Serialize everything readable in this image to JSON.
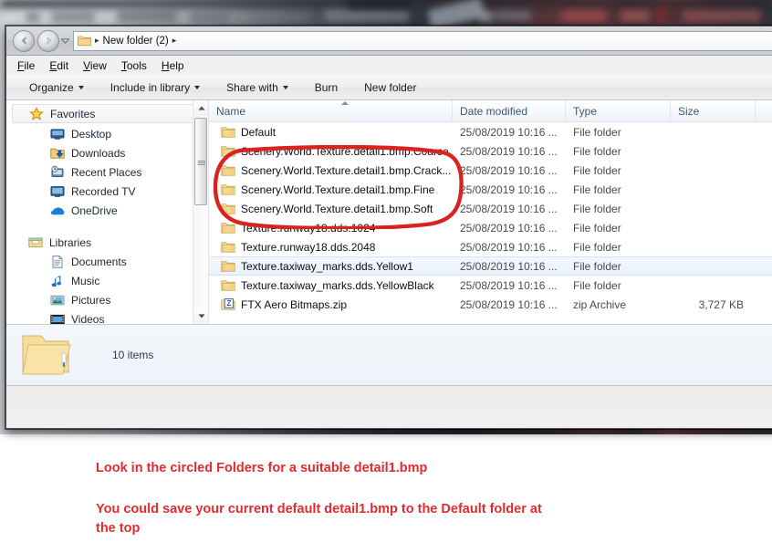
{
  "window": {
    "address": {
      "folder_icon": "folder-icon",
      "back_icon": "back-arrow-icon",
      "forward_icon": "forward-arrow-icon",
      "history_icon": "recent-pages-chevron-icon",
      "separator": "▸",
      "crumb": "New folder (2)"
    },
    "menubar": [
      {
        "name": "file",
        "accel": "F",
        "rest": "ile"
      },
      {
        "name": "edit",
        "accel": "E",
        "rest": "dit"
      },
      {
        "name": "view",
        "accel": "V",
        "rest": "iew"
      },
      {
        "name": "tools",
        "accel": "T",
        "rest": "ools"
      },
      {
        "name": "help",
        "accel": "H",
        "rest": "elp"
      }
    ],
    "commandbar": [
      {
        "label": "Organize",
        "caret": true
      },
      {
        "label": "Include in library",
        "caret": true
      },
      {
        "label": "Share with",
        "caret": true
      },
      {
        "label": "Burn",
        "caret": false
      },
      {
        "label": "New folder",
        "caret": false
      }
    ]
  },
  "navpane": {
    "favorites": {
      "label": "Favorites",
      "icon": "star-icon"
    },
    "favorites_items": [
      {
        "label": "Desktop",
        "icon": "desktop-icon"
      },
      {
        "label": "Downloads",
        "icon": "downloads-folder-icon"
      },
      {
        "label": "Recent Places",
        "icon": "recent-places-icon"
      },
      {
        "label": "Recorded TV",
        "icon": "monitor-icon"
      },
      {
        "label": "OneDrive",
        "icon": "cloud-icon"
      }
    ],
    "libraries": {
      "label": "Libraries",
      "icon": "libraries-icon"
    },
    "libraries_items": [
      {
        "label": "Documents",
        "icon": "document-icon"
      },
      {
        "label": "Music",
        "icon": "music-note-icon"
      },
      {
        "label": "Pictures",
        "icon": "picture-icon"
      },
      {
        "label": "Videos",
        "icon": "video-film-icon"
      }
    ],
    "scrollbar": {
      "up_icon": "scroll-up-arrow-icon",
      "down_icon": "scroll-down-arrow-icon"
    }
  },
  "filelist": {
    "columns": [
      {
        "key": "name",
        "label": "Name",
        "sorted": "asc"
      },
      {
        "key": "date",
        "label": "Date modified"
      },
      {
        "key": "type",
        "label": "Type"
      },
      {
        "key": "size",
        "label": "Size"
      }
    ],
    "rows": [
      {
        "name": "Default",
        "date": "25/08/2019 10:16 ...",
        "type": "File folder",
        "size": "",
        "icon": "folder-icon",
        "selected": false,
        "circled": false
      },
      {
        "name": "Scenery.World.Texture.detail1.bmp.Coarse",
        "date": "25/08/2019 10:16 ...",
        "type": "File folder",
        "size": "",
        "icon": "folder-icon",
        "selected": false,
        "circled": true
      },
      {
        "name": "Scenery.World.Texture.detail1.bmp.Crack...",
        "date": "25/08/2019 10:16 ...",
        "type": "File folder",
        "size": "",
        "icon": "folder-icon",
        "selected": false,
        "circled": true
      },
      {
        "name": "Scenery.World.Texture.detail1.bmp.Fine",
        "date": "25/08/2019 10:16 ...",
        "type": "File folder",
        "size": "",
        "icon": "folder-icon",
        "selected": false,
        "circled": true
      },
      {
        "name": "Scenery.World.Texture.detail1.bmp.Soft",
        "date": "25/08/2019 10:16 ...",
        "type": "File folder",
        "size": "",
        "icon": "folder-icon",
        "selected": false,
        "circled": true
      },
      {
        "name": "Texture.runway18.dds.1024",
        "date": "25/08/2019 10:16 ...",
        "type": "File folder",
        "size": "",
        "icon": "folder-icon",
        "selected": false,
        "circled": false
      },
      {
        "name": "Texture.runway18.dds.2048",
        "date": "25/08/2019 10:16 ...",
        "type": "File folder",
        "size": "",
        "icon": "folder-icon",
        "selected": false,
        "circled": false
      },
      {
        "name": "Texture.taxiway_marks.dds.Yellow1",
        "date": "25/08/2019 10:16 ...",
        "type": "File folder",
        "size": "",
        "icon": "folder-icon",
        "selected": true,
        "circled": false
      },
      {
        "name": "Texture.taxiway_marks.dds.YellowBlack",
        "date": "25/08/2019 10:16 ...",
        "type": "File folder",
        "size": "",
        "icon": "folder-icon",
        "selected": false,
        "circled": false
      },
      {
        "name": "FTX Aero Bitmaps.zip",
        "date": "25/08/2019 10:16 ...",
        "type": "zip Archive",
        "size": "3,727 KB",
        "icon": "zip-archive-icon",
        "selected": false,
        "circled": false
      }
    ]
  },
  "details": {
    "icon": "open-folder-icon",
    "item_count": "10 items"
  },
  "annotation": {
    "ring_color": "#d9231f",
    "text_color": "#e12b30",
    "lines": [
      "Look in the circled Folders for a suitable detail1.bmp",
      "You could save your current default detail1.bmp to the Default folder at",
      "the top"
    ]
  }
}
